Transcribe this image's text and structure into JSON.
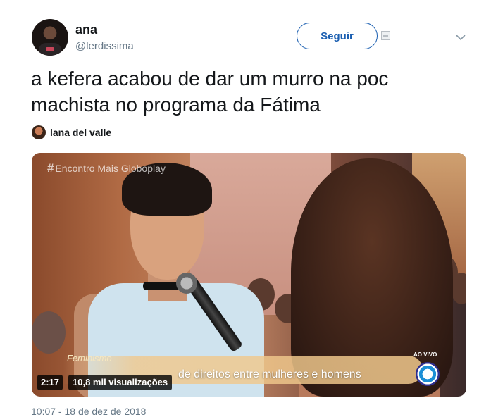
{
  "user": {
    "name": "ana",
    "handle": "@lerdissima"
  },
  "follow_button": {
    "label": "Seguir"
  },
  "tweet": {
    "text": "a kefera acabou de dar um murro na poc\nmachista no programa da Fátima"
  },
  "tagged_user": {
    "name": "lana del valle"
  },
  "video": {
    "watermark_hash": "#",
    "watermark_text": "Encontro Mais Globoplay",
    "lower_third_small": "Feminismo",
    "lower_third_main": "de direitos entre mulheres e homens",
    "live_label": "AO VIVO",
    "duration": "2:17",
    "views": "10,8 mil visualizações"
  },
  "timestamp": "10:07 - 18 de dez de 2018",
  "icons": {
    "caret": "chevron-down-icon",
    "broken_image": "image-icon",
    "broadcaster_logo": "globo-logo-icon"
  },
  "colors": {
    "accent": "#1b5fb1",
    "text": "#14171a",
    "muted": "#657786"
  }
}
